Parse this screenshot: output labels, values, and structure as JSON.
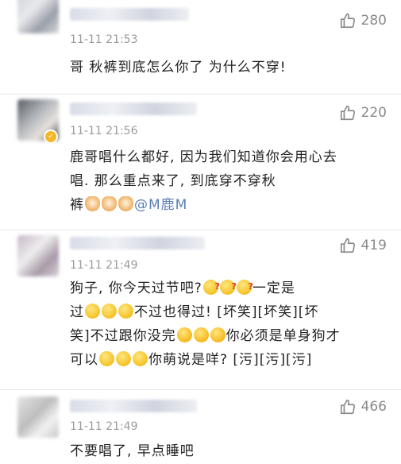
{
  "comments": [
    {
      "time": "11-11 21:53",
      "likes": "280",
      "text": "哥 秋裤到底怎么你了 为什么不穿!"
    },
    {
      "time": "11-11 21:56",
      "likes": "220",
      "text_line1": "鹿哥唱什么都好, 因为我们知道你会用心去",
      "text_line2": "唱. 那么重点来了, 到底穿不穿秋",
      "text_line3_prefix": "裤",
      "mention": "@M鹿M"
    },
    {
      "time": "11-11 21:49",
      "likes": "419",
      "l1_a": "狗子, 你今天过节吧?",
      "l1_b": "一定是",
      "l2_a": "过",
      "l2_b": "不过也得过! [坏笑][坏笑][坏",
      "l3_a": "笑]不过跟你没完",
      "l3_b": "你必须是单身狗才",
      "l4_a": "可以",
      "l4_b": "你萌说是咩? [污][污][污]"
    },
    {
      "time": "11-11 21:49",
      "likes": "466",
      "text": "不要唱了, 早点睡吧"
    }
  ],
  "icons": {
    "like": "thumbs-up-icon",
    "verified": "verified-badge-icon",
    "emoji_confused": "confused-face-emoji",
    "emoji_smile": "smile-face-emoji",
    "emoji_laugh": "laugh-tears-emoji",
    "emoji_cat": "cat-face-emoji"
  },
  "colors": {
    "mention": "#5b7fb4",
    "meta": "#9a9a9a",
    "badge": "#f5b728"
  }
}
